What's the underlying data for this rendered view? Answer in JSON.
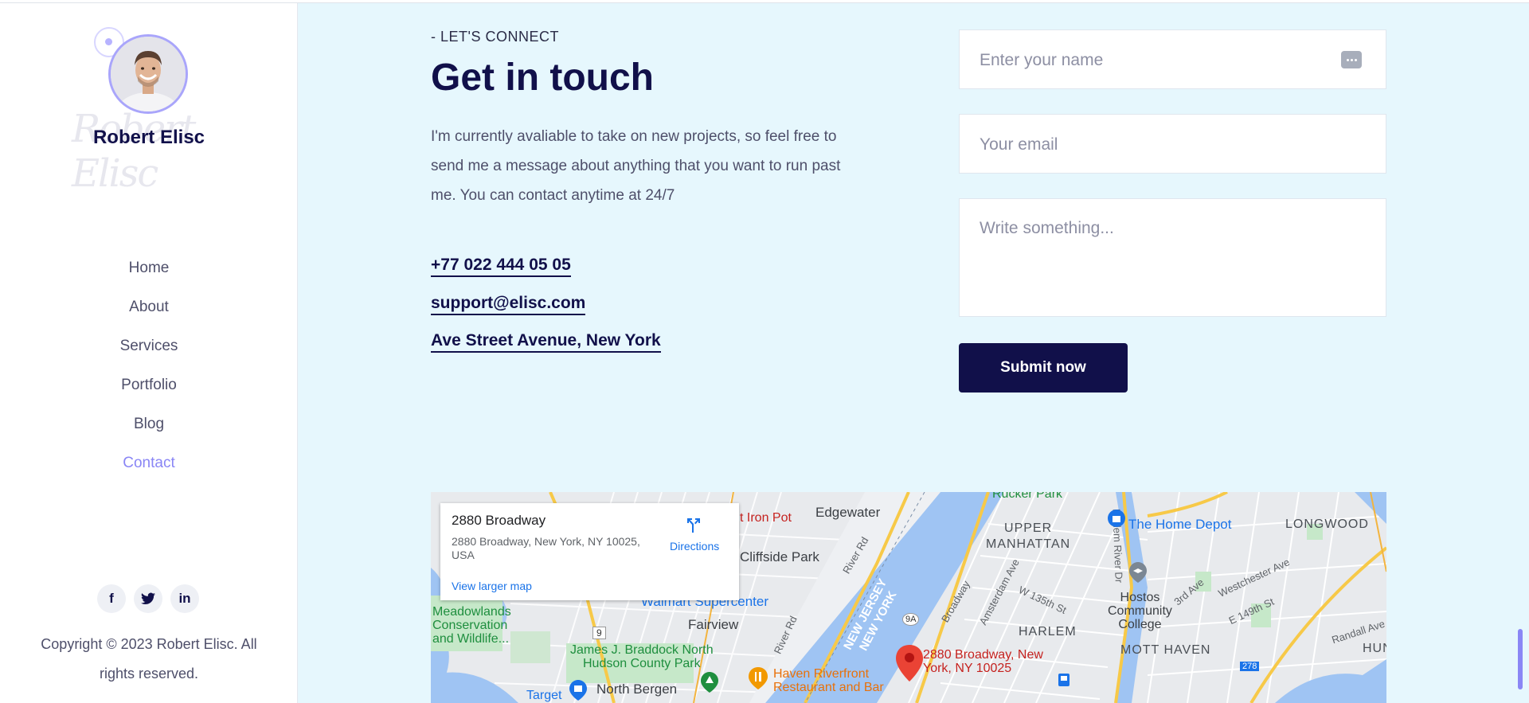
{
  "profile": {
    "name": "Robert Elisc",
    "signature": "Robert Elisc"
  },
  "nav": {
    "items": [
      {
        "label": "Home"
      },
      {
        "label": "About"
      },
      {
        "label": "Services"
      },
      {
        "label": "Portfolio"
      },
      {
        "label": "Blog"
      },
      {
        "label": "Contact",
        "active": true
      }
    ]
  },
  "social": {
    "facebook": "f",
    "twitter": "twitter-icon",
    "linkedin": "in"
  },
  "footer": {
    "copyright": "Copyright © 2023 Robert Elisc. All rights reserved."
  },
  "contact": {
    "eyebrow": "- LET'S CONNECT",
    "title": "Get in touch",
    "intro": "I'm currently avaliable to take on new projects, so feel free to send me a message about anything that you want to run past me. You can contact anytime at 24/7",
    "phone": "+77 022 444 05 05",
    "email": "support@elisc.com",
    "address": "Ave Street Avenue, New York"
  },
  "form": {
    "name_placeholder": "Enter your name",
    "email_placeholder": "Your email",
    "message_placeholder": "Write something...",
    "submit_label": "Submit now"
  },
  "map": {
    "card_title": "2880 Broadway",
    "card_address": "2880 Broadway, New York, NY 10025, USA",
    "directions_label": "Directions",
    "larger_map_label": "View larger map",
    "pin_label": "2880 Broadway, New York, NY 10025",
    "labels": {
      "iron_pot": "t Iron Pot",
      "edgewater": "Edgewater",
      "cliffside": "Cliffside Park",
      "river_rd_top": "River Rd",
      "rucker": "Rucker Park",
      "upper_manhattan": "UPPER\nMANHATTAN",
      "harlem_river_dr": "Harlem River Dr",
      "home_depot": "The Home Depot",
      "longwood": "LONGWOOD",
      "walmart": "Walmart Supercenter",
      "meadowlands": "Meadowlands\nConservation\nand Wildlife...",
      "fairview": "Fairview",
      "nj_ny": "NEW JERSEY\nNEW YORK",
      "broadway": "Broadway",
      "amsterdam": "Amsterdam Ave",
      "w135": "W 135th St",
      "hostos": "Hostos\nCommunity\nCollege",
      "harlem": "HARLEM",
      "mott_haven": "MOTT HAVEN",
      "braddock": "James J. Braddock North\nHudson County Park",
      "river_rd_low": "River Rd",
      "haven": "Haven Riverfront\nRestaurant and Bar",
      "north_bergen": "North Bergen",
      "target": "Target",
      "third_ave": "3rd Ave",
      "westchester": "Westchester Ave",
      "e149": "E 149th St",
      "randall": "Randall Ave",
      "hun": "HUN",
      "route9": "9",
      "route9a": "9A",
      "route278": "278"
    }
  }
}
